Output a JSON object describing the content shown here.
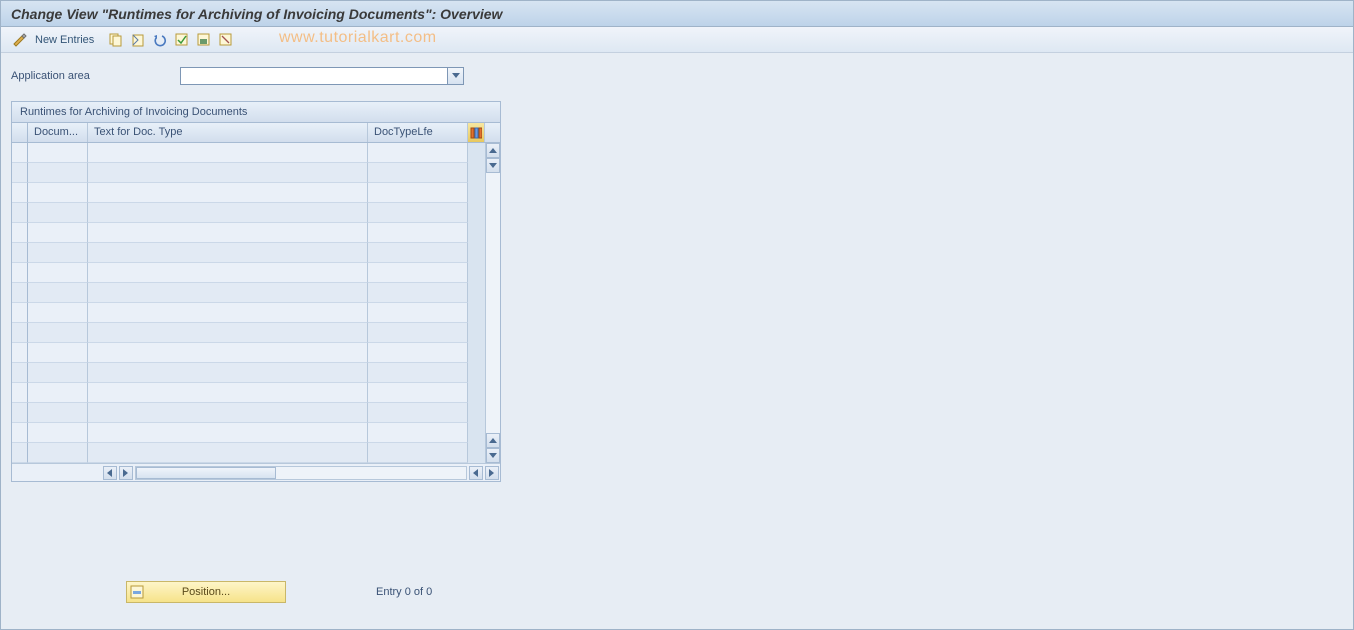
{
  "header": {
    "title": "Change View \"Runtimes for Archiving of Invoicing Documents\": Overview"
  },
  "toolbar": {
    "new_entries_label": "New Entries"
  },
  "watermark": "www.tutorialkart.com",
  "fields": {
    "application_area_label": "Application area",
    "application_area_value": ""
  },
  "table": {
    "caption": "Runtimes for Archiving of Invoicing Documents",
    "columns": {
      "doc": "Docum...",
      "text": "Text for Doc. Type",
      "dtl": "DocTypeLfe"
    },
    "row_count": 16
  },
  "footer": {
    "position_label": "Position...",
    "entry_text": "Entry 0 of 0"
  }
}
